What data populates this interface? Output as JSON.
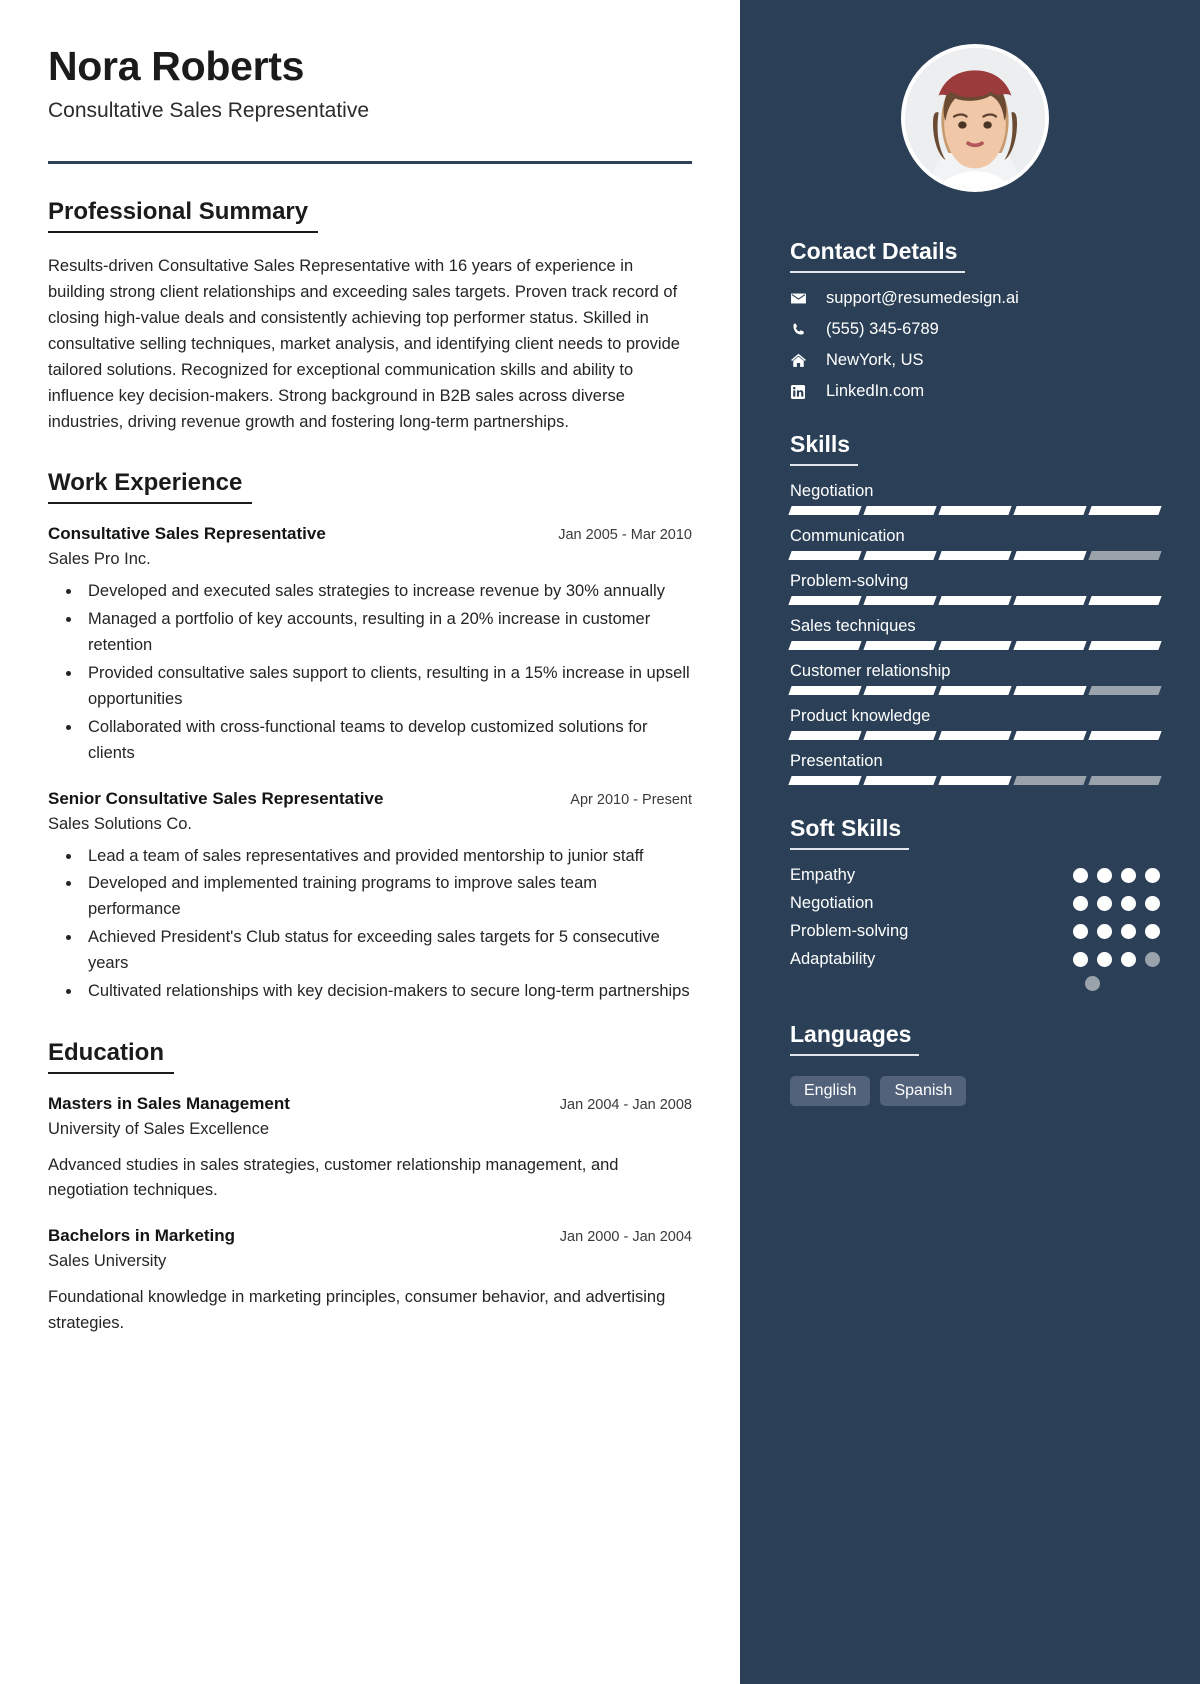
{
  "header": {
    "name": "Nora Roberts",
    "job_title": "Consultative Sales Representative"
  },
  "summary": {
    "heading": "Professional Summary",
    "text": "Results-driven Consultative Sales Representative with 16 years of experience in building strong client relationships and exceeding sales targets. Proven track record of closing high-value deals and consistently achieving top performer status. Skilled in consultative selling techniques, market analysis, and identifying client needs to provide tailored solutions. Recognized for exceptional communication skills and ability to influence key decision-makers. Strong background in B2B sales across diverse industries, driving revenue growth and fostering long-term partnerships."
  },
  "work": {
    "heading": "Work Experience",
    "entries": [
      {
        "role": "Consultative Sales Representative",
        "date": "Jan 2005 - Mar 2010",
        "org": "Sales Pro Inc.",
        "bullets": [
          "Developed and executed sales strategies to increase revenue by 30% annually",
          "Managed a portfolio of key accounts, resulting in a 20% increase in customer retention",
          "Provided consultative sales support to clients, resulting in a 15% increase in upsell opportunities",
          "Collaborated with cross-functional teams to develop customized solutions for clients"
        ]
      },
      {
        "role": "Senior Consultative Sales Representative",
        "date": "Apr 2010 - Present",
        "org": "Sales Solutions Co.",
        "bullets": [
          "Lead a team of sales representatives and provided mentorship to junior staff",
          "Developed and implemented training programs to improve sales team performance",
          "Achieved President's Club status for exceeding sales targets for 5 consecutive years",
          "Cultivated relationships with key decision-makers to secure long-term partnerships"
        ]
      }
    ]
  },
  "education": {
    "heading": "Education",
    "entries": [
      {
        "degree": "Masters in Sales Management",
        "date": "Jan 2004 - Jan 2008",
        "school": "University of Sales Excellence",
        "description": "Advanced studies in sales strategies, customer relationship management, and negotiation techniques."
      },
      {
        "degree": "Bachelors in Marketing",
        "date": "Jan 2000 - Jan 2004",
        "school": "Sales University",
        "description": "Foundational knowledge in marketing principles, consumer behavior, and advertising strategies."
      }
    ]
  },
  "sidebar": {
    "contact": {
      "heading": "Contact Details",
      "items": [
        {
          "icon": "envelope-icon",
          "value": "support@resumedesign.ai"
        },
        {
          "icon": "phone-icon",
          "value": "(555) 345-6789"
        },
        {
          "icon": "home-icon",
          "value": "NewYork, US"
        },
        {
          "icon": "linkedin-icon",
          "value": "LinkedIn.com"
        }
      ]
    },
    "skills": {
      "heading": "Skills",
      "segments_total": 5,
      "items": [
        {
          "name": "Negotiation",
          "filled": 5
        },
        {
          "name": "Communication",
          "filled": 4
        },
        {
          "name": "Problem-solving",
          "filled": 5
        },
        {
          "name": "Sales techniques",
          "filled": 5
        },
        {
          "name": "Customer relationship",
          "filled": 4
        },
        {
          "name": "Product knowledge",
          "filled": 5
        },
        {
          "name": "Presentation",
          "filled": 3
        }
      ]
    },
    "soft_skills": {
      "heading": "Soft Skills",
      "dots_total": 4,
      "items": [
        {
          "name": "Empathy",
          "filled": 4
        },
        {
          "name": "Negotiation",
          "filled": 4
        },
        {
          "name": "Problem-solving",
          "filled": 4
        },
        {
          "name": "Adaptability",
          "filled": 3
        }
      ],
      "extra_dot_filled": false
    },
    "languages": {
      "heading": "Languages",
      "items": [
        "English",
        "Spanish"
      ]
    }
  },
  "colors": {
    "sidebar_bg": "#2b4057",
    "rule": "#2e4257",
    "chip_bg": "#51627a",
    "muted": "#9aa3ab"
  }
}
